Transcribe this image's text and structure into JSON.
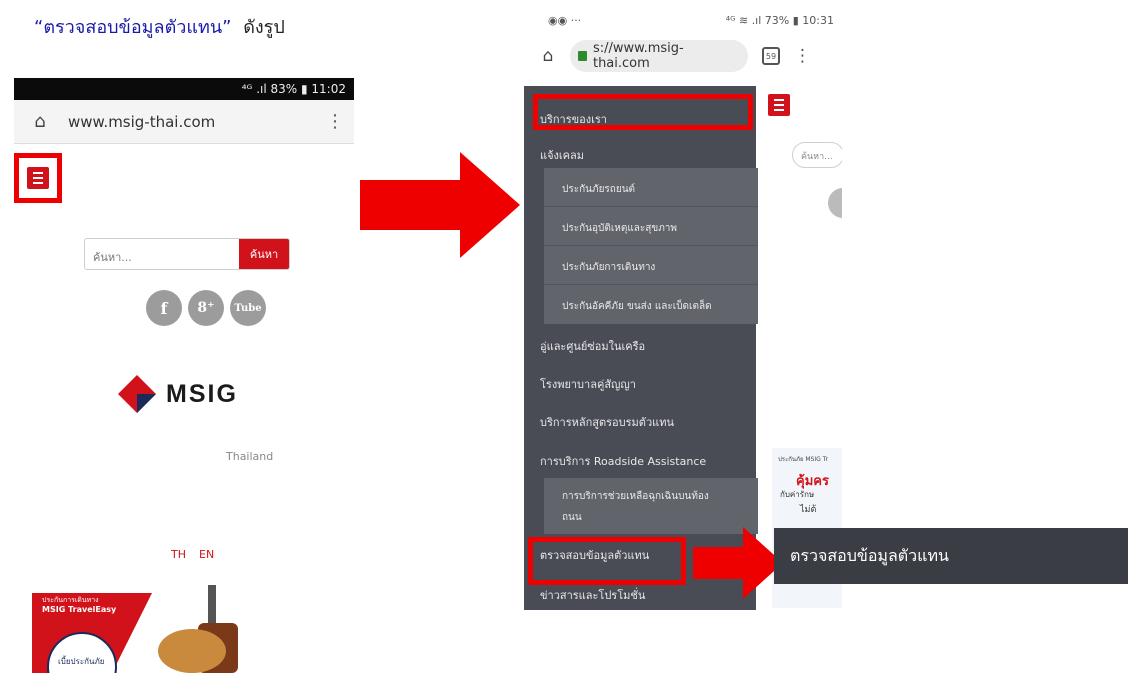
{
  "heading": {
    "quoted": "“ตรวจสอบข้อมูลตัวแทน”",
    "suffix": "ดังรูป"
  },
  "phone1": {
    "status_bar": "⁴ᴳ .ıl 83% ▮ 11:02",
    "url": "www.msig-thai.com",
    "search_placeholder": "ค้นหา...",
    "search_button": "ค้นหา",
    "social": [
      "f",
      "8⁺",
      "Tube"
    ],
    "logo_text": "MSIG",
    "logo_sub": "Thailand",
    "lang_th": "TH",
    "lang_en": "EN",
    "banner_line1": "ประกันการเดินทาง",
    "banner_line2": "MSIG TravelEasy",
    "banner_line3": "เบี้ยประกันภัย"
  },
  "phone2": {
    "status_left": "◉◉ ···",
    "status_right": "⁴ᴳ ≋ .ıl 73% ▮ 10:31",
    "url": "s://www.msig-thai.com",
    "tab_count": "59",
    "side_search": "ค้นหา...",
    "menu": {
      "top": [
        {
          "label": "บริการของเรา"
        },
        {
          "label": "แจ้งเคลม"
        }
      ],
      "sub1": [
        {
          "label": "ประกันภัยรถยนต์"
        },
        {
          "label": "ประกันอุบัติเหตุและสุขภาพ"
        },
        {
          "label": "ประกันภัยการเดินทาง"
        },
        {
          "label": "ประกันอัคคีภัย ขนส่ง และเบ็ดเตล็ด"
        }
      ],
      "mid": [
        {
          "label": "อู่และศูนย์ซ่อมในเครือ"
        },
        {
          "label": "โรงพยาบาลคู่สัญญา"
        },
        {
          "label": "บริการหลักสูตรอบรมตัวแทน"
        },
        {
          "label": "การบริการ Roadside Assistance"
        }
      ],
      "sub2": [
        {
          "label": "การบริการช่วยเหลือฉุกเฉินบนท้อง"
        },
        {
          "label": "ถนน"
        }
      ],
      "bottom": [
        {
          "label": "ตรวจสอบข้อมูลตัวแทน"
        },
        {
          "label": "ข่าวสารและโปรโมชั่น"
        }
      ]
    },
    "ad": {
      "line1": "ประกันภัย MSIG Tr",
      "line2": "คุ้มคร",
      "line3": "กับค่ารักษ",
      "line4": "ไม่ต้"
    }
  },
  "callout": {
    "text": "ตรวจสอบข้อมูลตัวแทน"
  },
  "colors": {
    "msig_red": "#d2121b",
    "highlight_red": "#ee0000",
    "drawer": "#4a4c55",
    "submenu": "#62646c",
    "heading_blue": "#1a1aa8"
  }
}
